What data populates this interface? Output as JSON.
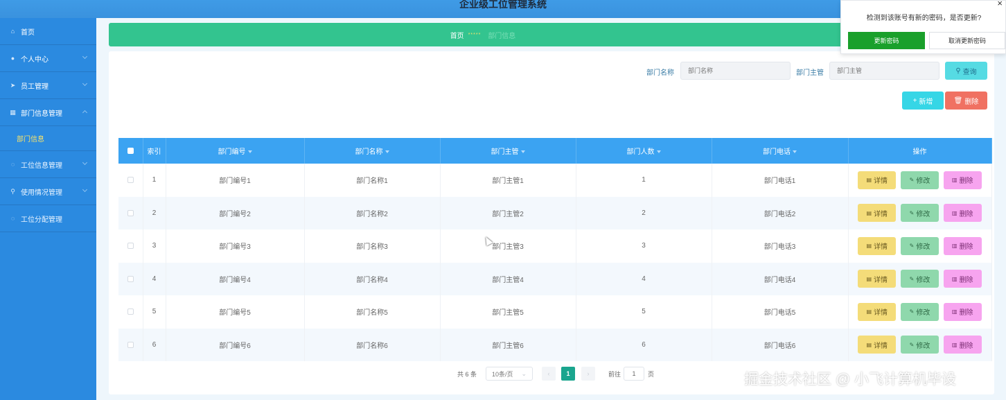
{
  "app": {
    "title": "企业级工位管理系统"
  },
  "sidebar": {
    "items": [
      {
        "label": "首页",
        "icon": "home-icon"
      },
      {
        "label": "个人中心",
        "icon": "user-icon"
      },
      {
        "label": "员工管理",
        "icon": "send-icon"
      },
      {
        "label": "部门信息管理",
        "icon": "building-icon"
      },
      {
        "label": "部门信息",
        "icon": ""
      },
      {
        "label": "工位信息管理",
        "icon": "circle-icon"
      },
      {
        "label": "使用情况管理",
        "icon": "lock-icon"
      },
      {
        "label": "工位分配管理",
        "icon": "circle-icon"
      }
    ]
  },
  "breadcrumb": {
    "home": "首页",
    "separator": "*****",
    "current": "部门信息"
  },
  "search": {
    "dept_name_label": "部门名称",
    "dept_name_placeholder": "部门名称",
    "dept_head_label": "部门主管",
    "dept_head_placeholder": "部门主管",
    "query_label": "查询"
  },
  "actions": {
    "add_label": "新增",
    "delete_label": "删除"
  },
  "table": {
    "columns": [
      "索引",
      "部门编号",
      "部门名称",
      "部门主管",
      "部门人数",
      "部门电话",
      "操作"
    ],
    "rows": [
      {
        "index": "1",
        "code": "部门编号1",
        "name": "部门名称1",
        "head": "部门主管1",
        "count": "1",
        "phone": "部门电话1"
      },
      {
        "index": "2",
        "code": "部门编号2",
        "name": "部门名称2",
        "head": "部门主管2",
        "count": "2",
        "phone": "部门电话2"
      },
      {
        "index": "3",
        "code": "部门编号3",
        "name": "部门名称3",
        "head": "部门主管3",
        "count": "3",
        "phone": "部门电话3"
      },
      {
        "index": "4",
        "code": "部门编号4",
        "name": "部门名称4",
        "head": "部门主管4",
        "count": "4",
        "phone": "部门电话4"
      },
      {
        "index": "5",
        "code": "部门编号5",
        "name": "部门名称5",
        "head": "部门主管5",
        "count": "5",
        "phone": "部门电话5"
      },
      {
        "index": "6",
        "code": "部门编号6",
        "name": "部门名称6",
        "head": "部门主管6",
        "count": "6",
        "phone": "部门电话6"
      }
    ],
    "row_actions": {
      "detail": "详情",
      "edit": "修改",
      "delete": "删除"
    }
  },
  "pagination": {
    "total": "共 6 条",
    "page_size": "10条/页",
    "current_page": "1",
    "goto_label": "前往",
    "goto_value": "1",
    "page_suffix": "页"
  },
  "popup": {
    "message": "检测到该账号有新的密码，是否更新?",
    "confirm": "更新密码",
    "cancel": "取消更新密码",
    "close": "×"
  },
  "watermark": "掘金技术社区 @ 小飞计算机毕设",
  "colors": {
    "sidebar": "#2b8ae0",
    "breadcrumb": "#33c48f",
    "table_header": "#3ba3f2",
    "popup_confirm": "#1aa02b"
  }
}
